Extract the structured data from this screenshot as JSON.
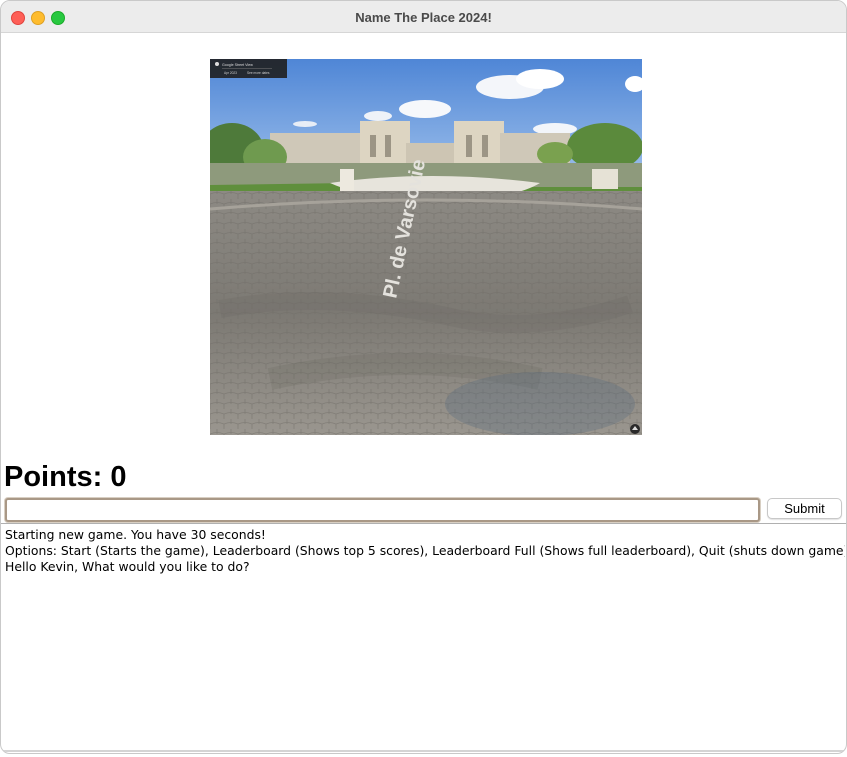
{
  "window": {
    "title": "Name The Place 2024!"
  },
  "photo": {
    "street_label": "Pl. de Varsovie",
    "badge_lines": [
      "Google Street View",
      "Apr 2023",
      "See more dates"
    ]
  },
  "score": {
    "label": "Points: 0"
  },
  "answer": {
    "value": "",
    "placeholder": ""
  },
  "submit": {
    "label": "Submit"
  },
  "log": {
    "lines": [
      "Starting new game. You have 30 seconds!",
      "Options: Start (Starts the game), Leaderboard (Shows top 5 scores), Leaderboard Full (Shows full leaderboard), Quit (shuts down game)",
      "Hello Kevin, What would you like to do?"
    ]
  }
}
